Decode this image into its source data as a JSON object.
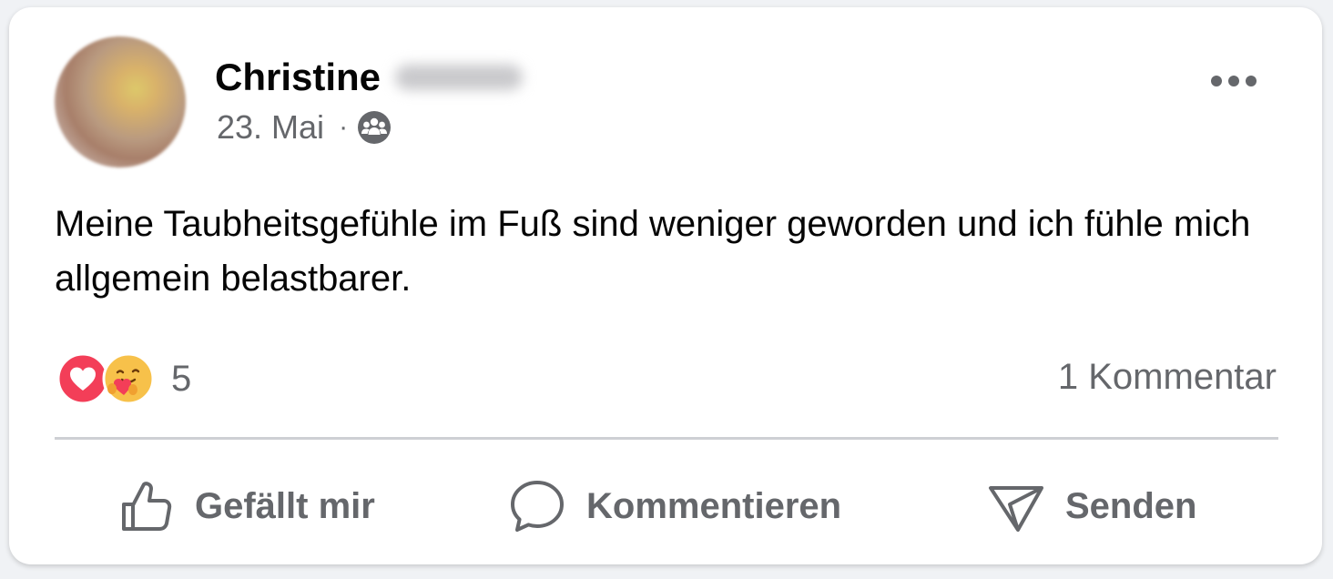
{
  "post": {
    "author_first_name": "Christine",
    "date": "23. Mai",
    "separator": "·",
    "audience_icon": "group-icon",
    "text": "Meine Taubheitsgefühle im Fuß sind weniger geworden und ich fühle mich allgemein belastbarer."
  },
  "stats": {
    "reaction_icons": [
      "love-reaction-icon",
      "care-reaction-icon"
    ],
    "reaction_count": "5",
    "comment_count": "1 Kommentar"
  },
  "actions": {
    "like_label": "Gefällt mir",
    "comment_label": "Kommentieren",
    "send_label": "Senden"
  },
  "colors": {
    "primary_text": "#050505",
    "secondary_text": "#65676b",
    "divider": "#ced0d4",
    "love_red": "#f33e58",
    "care_yellow": "#f7b125"
  }
}
